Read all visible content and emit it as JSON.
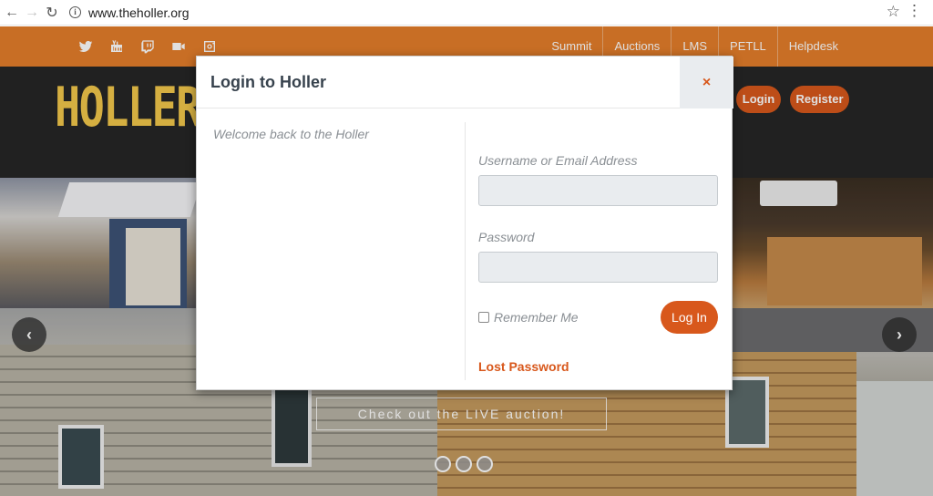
{
  "browser": {
    "url": "www.theholler.org",
    "back_glyph": "←",
    "forward_glyph": "→",
    "reload_glyph": "↻",
    "star_glyph": "☆",
    "menu_glyph": "⋮",
    "info_glyph": "i"
  },
  "topbar": {
    "color": "#e47e2b",
    "social_icons": [
      "twitter-icon",
      "youtube-icon",
      "twitch-icon",
      "video-camera-icon",
      "instagram-icon"
    ],
    "nav": [
      "Summit",
      "Auctions",
      "LMS",
      "PETLL",
      "Helpdesk"
    ]
  },
  "header": {
    "logo_text": "HOLLER",
    "logo_color": "#f3c84a",
    "login_label": "Login",
    "register_label": "Register",
    "accent": "#d8581c"
  },
  "hero": {
    "cta_label": "Check out the LIVE auction!",
    "prev_glyph": "‹",
    "next_glyph": "›",
    "slide_count": 3
  },
  "modal": {
    "title": "Login to Holler",
    "close_glyph": "×",
    "welcome_text": "Welcome back to the Holler",
    "username_label": "Username or Email Address",
    "username_value": "",
    "password_label": "Password",
    "password_value": "",
    "remember_label": "Remember Me",
    "remember_checked": false,
    "submit_label": "Log In",
    "lost_password_label": "Lost Password"
  }
}
